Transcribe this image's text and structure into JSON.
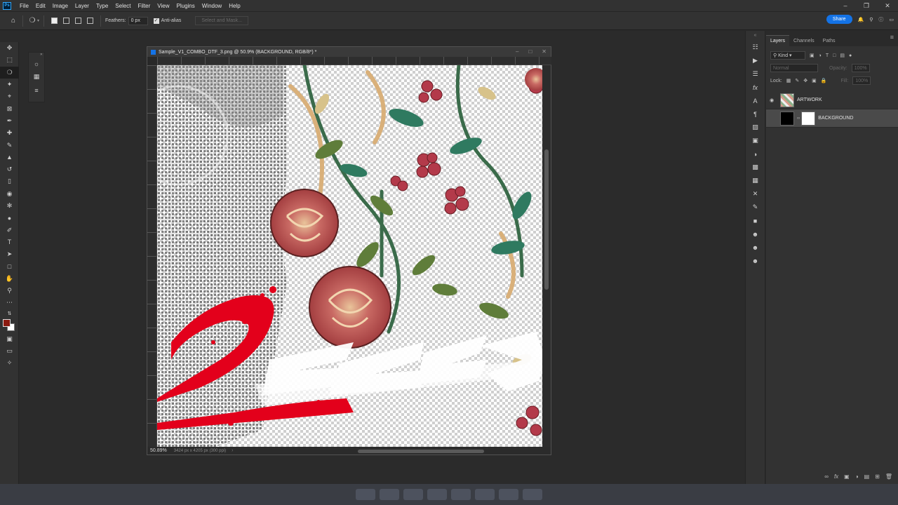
{
  "menubar": {
    "items": [
      "File",
      "Edit",
      "Image",
      "Layer",
      "Type",
      "Select",
      "Filter",
      "View",
      "Plugins",
      "Window",
      "Help"
    ]
  },
  "optionsbar": {
    "feather_label": "Feathers:",
    "feather_value": "0 px",
    "antialias_label": "Anti-alias",
    "select_mask_label": "Select and Mask...",
    "share_label": "Share"
  },
  "document": {
    "title": "Sample_V1_COMBO_DTF_3.png @ 50.9% (BACKGROUND, RGB/8*) *",
    "zoom": "50.89%",
    "info": "3424 px x 4205 px (300 ppi)"
  },
  "panel": {
    "tabs": [
      "Layers",
      "Channels",
      "Paths"
    ],
    "active_tab": "Layers",
    "filter_kind": "Kind",
    "blend_mode": "Normal",
    "opacity_label": "Opacity:",
    "opacity_value": "100%",
    "lock_label": "Lock:",
    "fill_label": "Fill:",
    "fill_value": "100%",
    "layers": [
      {
        "name": "ARTWORK",
        "visible": true,
        "selected": false
      },
      {
        "name": "BACKGROUND",
        "visible": false,
        "selected": true
      }
    ]
  },
  "colors": {
    "foreground": "#8b1a10",
    "background": "#ffffff",
    "accent": "#1473e6"
  }
}
